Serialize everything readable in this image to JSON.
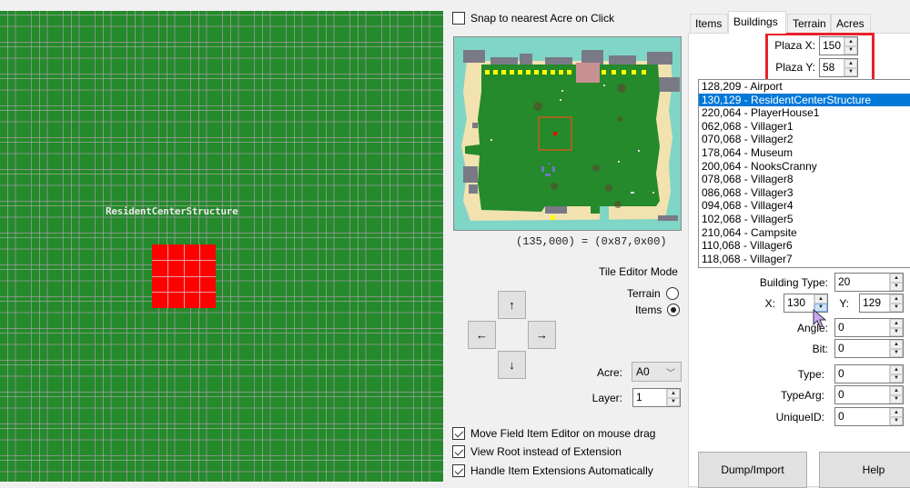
{
  "map": {
    "building_label": "ResidentCenterStructure",
    "building_tile_color": "#ff0000",
    "grass_color": "#248a2b"
  },
  "options": {
    "snap_acre": {
      "label": "Snap to nearest Acre on Click",
      "checked": false
    },
    "move_editor": {
      "label": "Move Field Item Editor on mouse drag",
      "checked": true
    },
    "view_root": {
      "label": "View Root instead of Extension",
      "checked": true
    },
    "handle_extensions": {
      "label": "Handle Item Extensions Automatically",
      "checked": true
    }
  },
  "minimap": {
    "coord_readout": "(135,000) = (0x87,0x00)",
    "colors": {
      "water": "#7fd5c6",
      "sand": "#f2e2b0",
      "grass": "#248a2b",
      "rock": "#7a7a86",
      "plaza": "#c89090",
      "marker": "#ffff00",
      "selection": "#c85a1e",
      "selected_dot": "#ff0000"
    }
  },
  "tile_editor": {
    "title": "Tile Editor Mode",
    "modes": [
      {
        "label": "Terrain",
        "selected": false
      },
      {
        "label": "Items",
        "selected": true
      }
    ],
    "arrows": {
      "up": "↑",
      "left": "←",
      "right": "→",
      "down": "↓"
    },
    "acre_label": "Acre:",
    "acre_value": "A0",
    "layer_label": "Layer:",
    "layer_value": "1"
  },
  "tabs": [
    {
      "label": "Items",
      "active": false
    },
    {
      "label": "Buildings",
      "active": true
    },
    {
      "label": "Terrain",
      "active": false
    },
    {
      "label": "Acres",
      "active": false
    }
  ],
  "buildings": {
    "plaza_x_label": "Plaza X:",
    "plaza_x": "150",
    "plaza_y_label": "Plaza Y:",
    "plaza_y": "58",
    "list": [
      "128,209 - Airport",
      "130,129 - ResidentCenterStructure",
      "220,064 - PlayerHouse1",
      "062,068 - Villager1",
      "070,068 - Villager2",
      "178,064 - Museum",
      "200,064 - NooksCranny",
      "078,068 - Villager8",
      "086,068 - Villager3",
      "094,068 - Villager4",
      "102,068 - Villager5",
      "210,064 - Campsite",
      "110,068 - Villager6",
      "118,068 - Villager7"
    ],
    "selected_index": 1,
    "fields": {
      "building_type_label": "Building Type:",
      "building_type": "20",
      "x_label": "X:",
      "x": "130",
      "y_label": "Y:",
      "y": "129",
      "angle_label": "Angle:",
      "angle": "0",
      "bit_label": "Bit:",
      "bit": "0",
      "type_label": "Type:",
      "type": "0",
      "typearg_label": "TypeArg:",
      "typearg": "0",
      "uniqueid_label": "UniqueID:",
      "uniqueid": "0"
    },
    "dump_import_label": "Dump/Import",
    "help_label": "Help"
  },
  "spin_glyphs": {
    "up": "▲",
    "down": "▼",
    "dropdown": "﹀"
  }
}
